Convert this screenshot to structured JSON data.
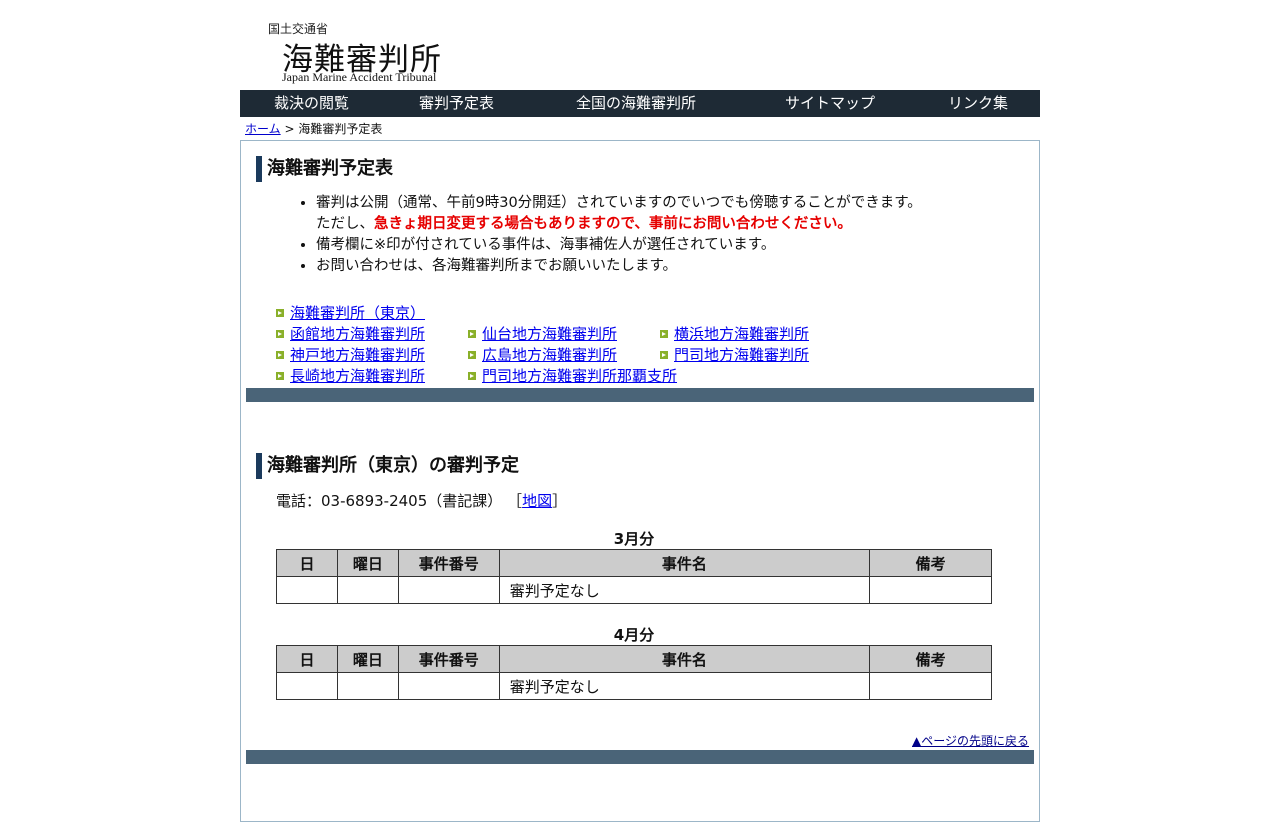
{
  "logo": {
    "ministry": "国土交通省",
    "name": "海難審判所",
    "english": "Japan Marine Accident Tribunal"
  },
  "nav": [
    "裁決の閲覧",
    "審判予定表",
    "全国の海難審判所",
    "サイトマップ",
    "リンク集"
  ],
  "breadcrumb": {
    "home": "ホーム",
    "sep": " > ",
    "current": "海難審判予定表"
  },
  "section1": {
    "title": "海難審判予定表",
    "notes": {
      "n1a": "審判は公開（通常、午前9時30分開廷）されていますのでいつでも傍聴することができます。",
      "n1b_plain": "ただし、",
      "n1b_warn": "急きょ期日変更する場合もありますので、事前にお問い合わせください。",
      "n2": "備考欄に※印が付されている事件は、海事補佐人が選任されています。",
      "n3": "お問い合わせは、各海難審判所までお願いいたします。"
    },
    "links": [
      "海難審判所（東京）",
      "函館地方海難審判所",
      "仙台地方海難審判所",
      "横浜地方海難審判所",
      "神戸地方海難審判所",
      "広島地方海難審判所",
      "門司地方海難審判所",
      "長崎地方海難審判所",
      "門司地方海難審判所那覇支所"
    ]
  },
  "section2": {
    "title": "海難審判所（東京）の審判予定",
    "phone_text": "電話：03-6893-2405（書記課）",
    "map_open": "［",
    "map_link": "地図",
    "map_close": "］",
    "headers": [
      "日",
      "曜日",
      "事件番号",
      "事件名",
      "備考"
    ],
    "months": [
      {
        "label": "3月分",
        "rows": [
          [
            "",
            "",
            "",
            "審判予定なし",
            ""
          ]
        ]
      },
      {
        "label": "4月分",
        "rows": [
          [
            "",
            "",
            "",
            "審判予定なし",
            ""
          ]
        ]
      }
    ]
  },
  "to_top": "▲ページの先頭に戻る"
}
